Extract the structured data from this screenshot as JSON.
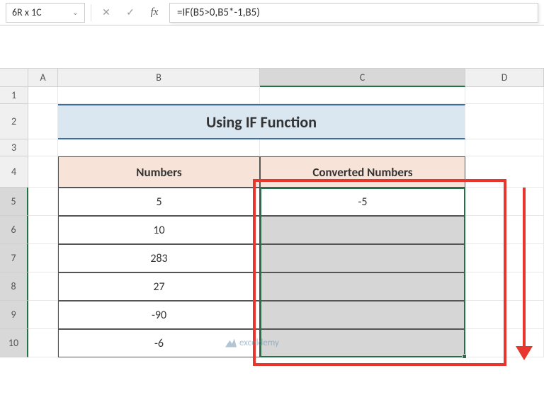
{
  "name_box": "6R x 1C",
  "formula": "=IF(B5>0,B5*-1,B5)",
  "columns": [
    "A",
    "B",
    "C",
    "D"
  ],
  "rows": [
    "1",
    "2",
    "3",
    "4",
    "5",
    "6",
    "7",
    "8",
    "9",
    "10"
  ],
  "title": "Using IF Function",
  "headers": {
    "numbers": "Numbers",
    "converted": "Converted Numbers"
  },
  "chart_data": {
    "type": "table",
    "title": "Using IF Function",
    "columns": [
      "Numbers",
      "Converted Numbers"
    ],
    "rows": [
      {
        "Numbers": 5,
        "Converted Numbers": -5
      },
      {
        "Numbers": 10,
        "Converted Numbers": null
      },
      {
        "Numbers": 283,
        "Converted Numbers": null
      },
      {
        "Numbers": 27,
        "Converted Numbers": null
      },
      {
        "Numbers": -90,
        "Converted Numbers": null
      },
      {
        "Numbers": -6,
        "Converted Numbers": null
      }
    ]
  },
  "watermark": "exceldemy",
  "icons": {
    "chevron": "⌄",
    "cancel": "✕",
    "confirm": "✓",
    "fx": "fx"
  }
}
